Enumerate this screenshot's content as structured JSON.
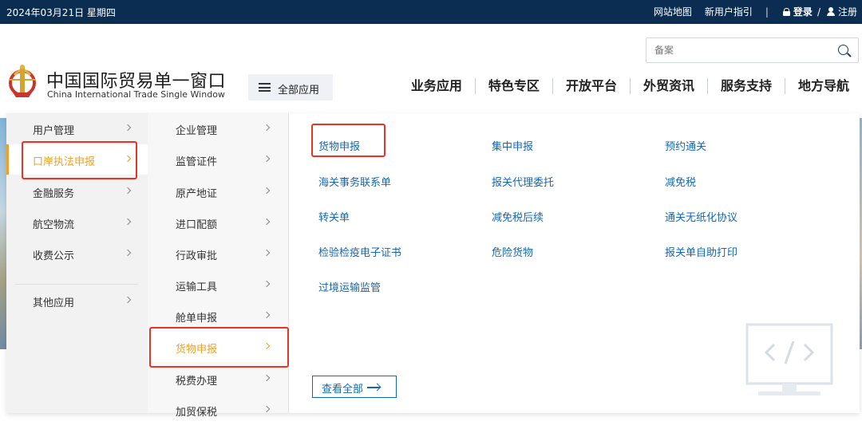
{
  "topbar": {
    "date": "2024年03月21日 星期四",
    "sitemap": "网站地图",
    "guide": "新用户指引",
    "separator": "|",
    "login": "登录",
    "slash": "/",
    "register": "注册"
  },
  "header": {
    "search_placeholder": "备案",
    "title_cn": "中国国际贸易单一窗口",
    "title_en": "China International Trade Single Window",
    "all_apps": "全部应用",
    "nav": [
      "业务应用",
      "特色专区",
      "开放平台",
      "外贸资讯",
      "服务支持",
      "地方导航"
    ]
  },
  "menu": {
    "col1": [
      "用户管理",
      "口岸执法申报",
      "金融服务",
      "航空物流",
      "收费公示",
      "其他应用"
    ],
    "col1_active": "口岸执法申报",
    "col2": [
      "企业管理",
      "监管证件",
      "原产地证",
      "进口配额",
      "行政审批",
      "运输工具",
      "舱单申报",
      "货物申报",
      "税费办理",
      "加贸保税"
    ],
    "col2_active": "货物申报",
    "links": [
      [
        "货物申报",
        "集中申报",
        "预约通关"
      ],
      [
        "海关事务联系单",
        "报关代理委托",
        "减免税"
      ],
      [
        "转关单",
        "减免税后续",
        "通关无纸化协议"
      ],
      [
        "检验检疫电子证书",
        "危险货物",
        "报关单自助打印"
      ],
      [
        "过境运输监管"
      ]
    ],
    "view_all": "查看全部"
  },
  "colors": {
    "topbar": "#0b2d52",
    "active": "#f0a024",
    "link": "#1467b4",
    "highlight_box": "#e53527"
  }
}
